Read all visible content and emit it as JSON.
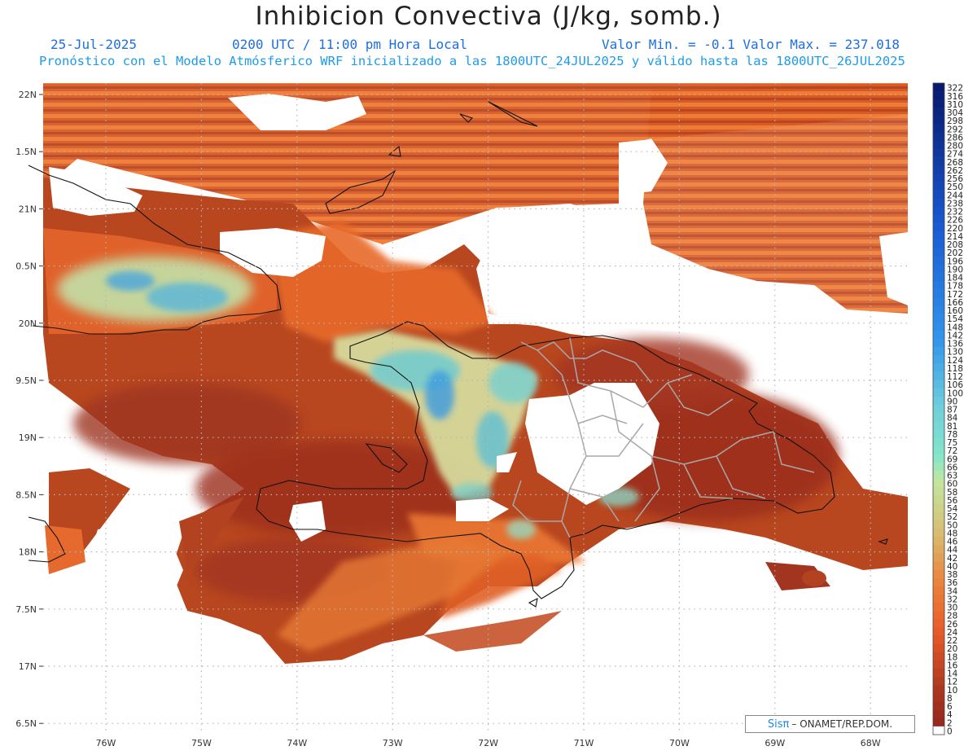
{
  "header": {
    "title": "Inhibicion Convectiva (J/kg, somb.)",
    "date": "25-Jul-2025",
    "time": "0200 UTC / 11:00 pm Hora Local",
    "minmax": "Valor Min. = -0.1  Valor Max. = 237.018",
    "model_line": "Pronóstico con el Modelo Atmósferico WRF inicializado a las 1800UTC_24JUL2025 y válido hasta las  1800UTC_26JUL2025"
  },
  "axes": {
    "lat_labels": [
      "22N",
      "1.5N",
      "21N",
      "0.5N",
      "20N",
      "9.5N",
      "19N",
      "8.5N",
      "18N",
      "7.5N",
      "17N",
      "6.5N"
    ],
    "lon_labels": [
      "76W",
      "75W",
      "74W",
      "73W",
      "72W",
      "71W",
      "70W",
      "69W",
      "68W"
    ]
  },
  "colorbar": {
    "labels": [
      "322",
      "316",
      "310",
      "304",
      "298",
      "292",
      "286",
      "280",
      "274",
      "268",
      "262",
      "256",
      "250",
      "244",
      "238",
      "232",
      "226",
      "220",
      "214",
      "208",
      "202",
      "196",
      "190",
      "184",
      "178",
      "172",
      "166",
      "160",
      "154",
      "148",
      "142",
      "136",
      "130",
      "124",
      "118",
      "112",
      "106",
      "100",
      "90",
      "87",
      "84",
      "81",
      "78",
      "75",
      "72",
      "69",
      "66",
      "63",
      "60",
      "58",
      "56",
      "54",
      "52",
      "50",
      "48",
      "46",
      "44",
      "42",
      "40",
      "38",
      "36",
      "34",
      "32",
      "30",
      "28",
      "26",
      "24",
      "22",
      "20",
      "18",
      "16",
      "14",
      "12",
      "10",
      "8",
      "6",
      "4",
      "2",
      "0"
    ]
  },
  "colors": {
    "low": "#9b2f1e",
    "mid": "#e8652a",
    "high_green": "#b9e6b0",
    "high_blue": "#2d8fe0",
    "boundary_country": "#111111",
    "boundary_province": "#a8a8a8"
  },
  "credit": {
    "logo": "Sisπ",
    "text": "– ONAMET/REP.DOM."
  }
}
